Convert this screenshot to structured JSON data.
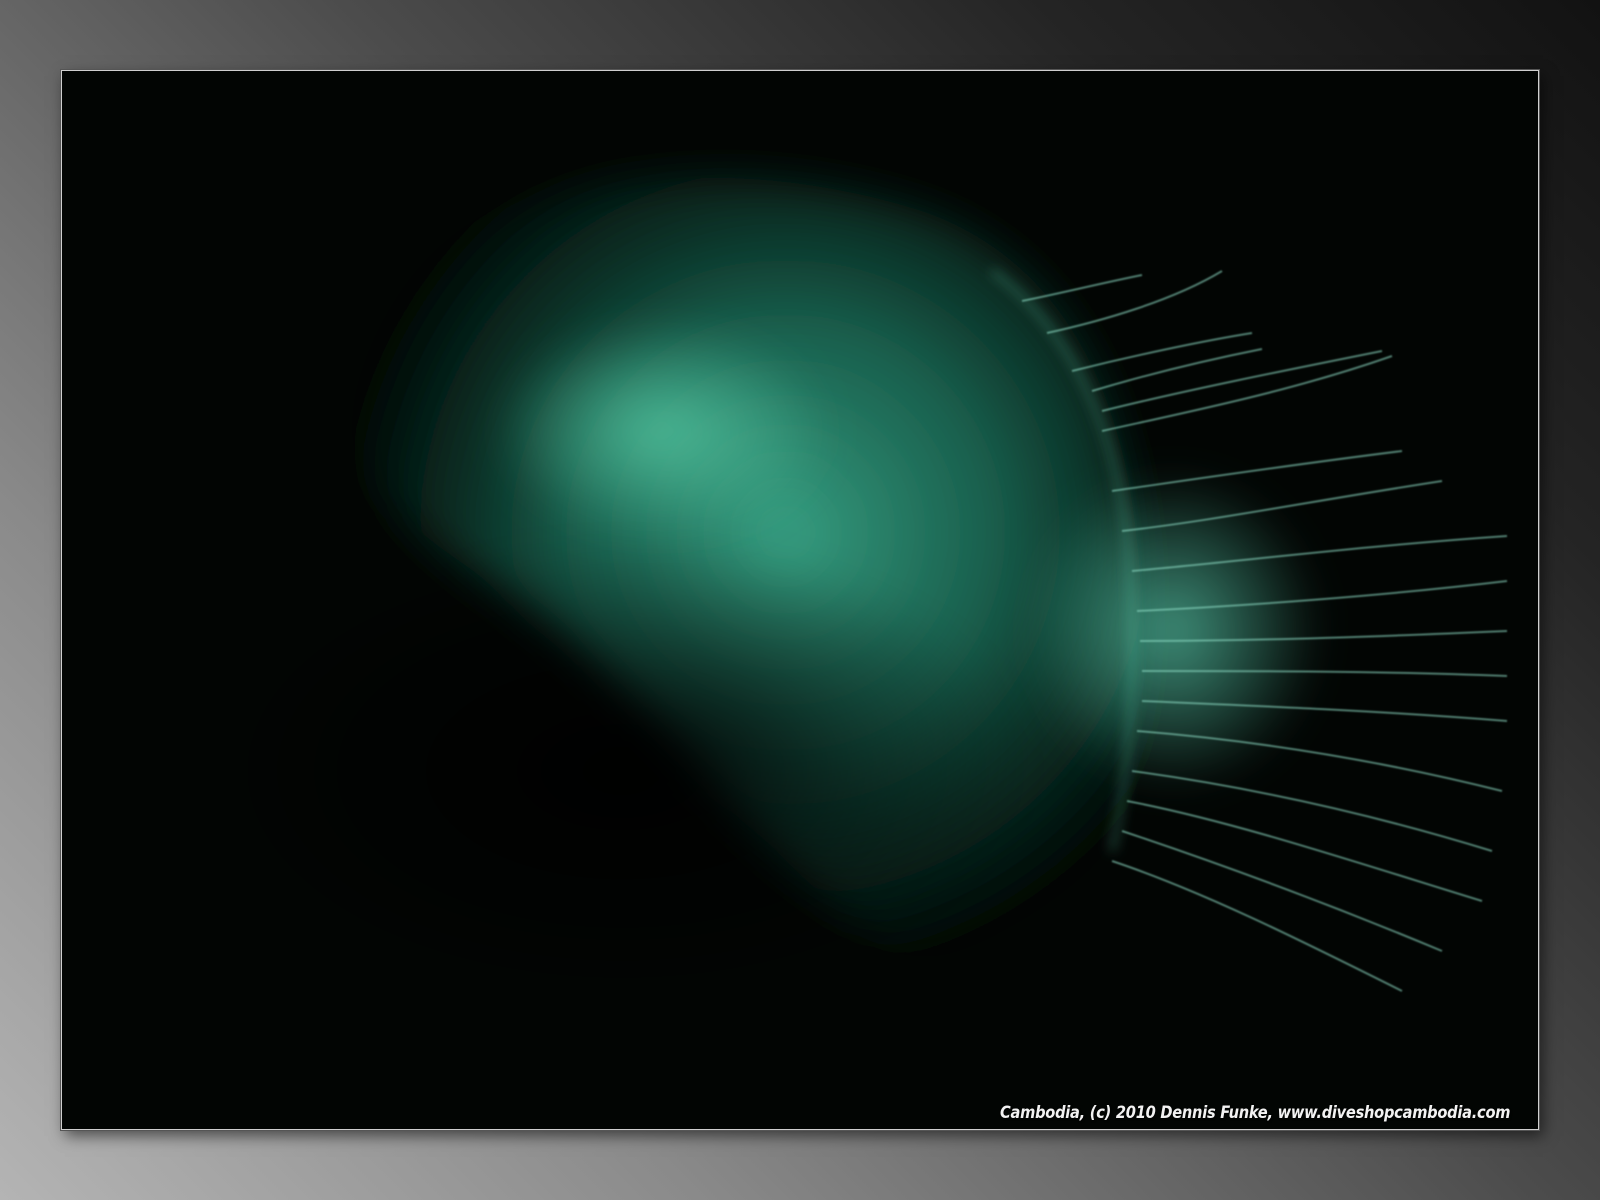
{
  "photo": {
    "subject_icon": "jellyfish-icon",
    "caption": "Cambodia, (c) 2010 Dennis Funke, www.diveshopcambodia.com"
  },
  "colors": {
    "background_light": "#b4b4b4",
    "background_dark": "#121212",
    "water": "#020503",
    "glow": "#3fbf98",
    "tentacle": "#8fe0c8"
  }
}
